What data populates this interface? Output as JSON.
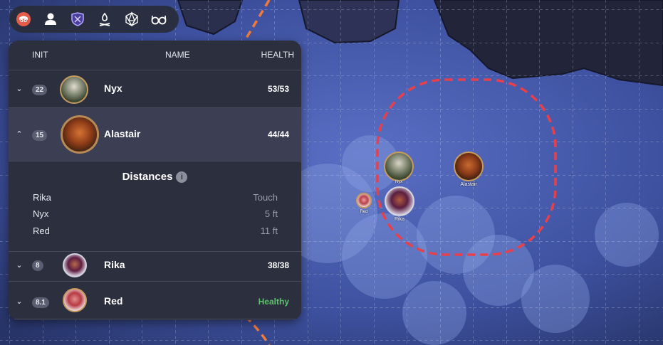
{
  "toolbar": {
    "icons": [
      "owlbear-logo-icon",
      "player-icon",
      "shield-swords-icon",
      "campfire-icon",
      "d20-dice-icon",
      "glasses-icon"
    ]
  },
  "initiative": {
    "columns": {
      "init": "INIT",
      "name": "NAME",
      "health": "HEALTH"
    },
    "rows": [
      {
        "init": "22",
        "name": "Nyx",
        "health": "53/53",
        "expanded": false
      },
      {
        "init": "15",
        "name": "Alastair",
        "health": "44/44",
        "expanded": true
      },
      {
        "init": "8",
        "name": "Rika",
        "health": "38/38",
        "expanded": false
      },
      {
        "init": "8.1",
        "name": "Red",
        "health": "Healthy",
        "expanded": false
      }
    ],
    "distances": {
      "title": "Distances",
      "info_glyph": "i",
      "items": [
        {
          "name": "Rika",
          "value": "Touch"
        },
        {
          "name": "Nyx",
          "value": "5 ft"
        },
        {
          "name": "Red",
          "value": "11 ft"
        }
      ]
    }
  },
  "map": {
    "tokens": [
      {
        "label": "Nyx"
      },
      {
        "label": "Alastair"
      },
      {
        "label": "Red"
      },
      {
        "label": "Rika"
      }
    ]
  },
  "colors": {
    "panel_bg": "#2c2f3e",
    "active_row": "#3c3f54",
    "healthy": "#5cc26a",
    "aura": "#e8404a",
    "path": "#f07a3a"
  }
}
